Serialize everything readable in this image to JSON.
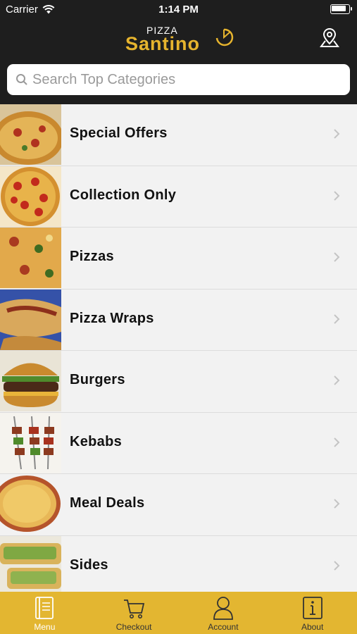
{
  "status_bar": {
    "carrier": "Carrier",
    "time": "1:14 PM",
    "battery_level": 0.9
  },
  "header": {
    "logo_top": "PIZZA",
    "logo_main": "Santino",
    "map_icon": "map-pin-icon"
  },
  "search": {
    "placeholder": "Search Top Categories",
    "value": ""
  },
  "categories": [
    {
      "label": "Special Offers"
    },
    {
      "label": "Collection Only"
    },
    {
      "label": "Pizzas"
    },
    {
      "label": "Pizza Wraps"
    },
    {
      "label": "Burgers"
    },
    {
      "label": "Kebabs"
    },
    {
      "label": "Meal Deals"
    },
    {
      "label": "Sides"
    }
  ],
  "tabs": [
    {
      "label": "Menu",
      "icon": "menu-book-icon",
      "active": true
    },
    {
      "label": "Checkout",
      "icon": "cart-icon",
      "active": false
    },
    {
      "label": "Account",
      "icon": "user-icon",
      "active": false
    },
    {
      "label": "About",
      "icon": "info-icon",
      "active": false
    }
  ],
  "colors": {
    "header_bg": "#1e1e1e",
    "brand_gold": "#e3b631",
    "list_bg": "#f2f2f2"
  }
}
